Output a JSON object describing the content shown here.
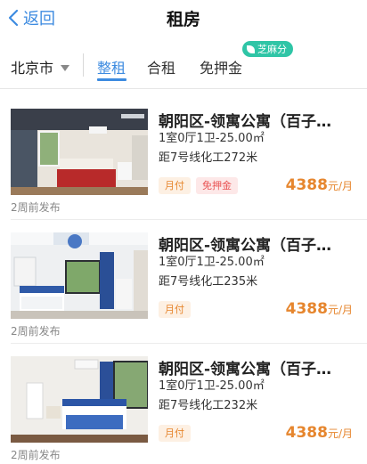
{
  "nav": {
    "back_label": "返回",
    "title": "租房"
  },
  "filter": {
    "city": "北京市",
    "tabs": [
      {
        "label": "整租",
        "active": true
      },
      {
        "label": "合租",
        "active": false
      },
      {
        "label": "免押金",
        "active": false
      }
    ],
    "sesame_badge": "芝麻分"
  },
  "listings": [
    {
      "title": "朝阳区-领寓公寓（百子…",
      "spec": "1室0厅1卫-25.00㎡",
      "distance": "距7号线化工272米",
      "tags": [
        "月付",
        "免押金"
      ],
      "price": "4388",
      "price_unit": "元/月",
      "posted": "2周前发布"
    },
    {
      "title": "朝阳区-领寓公寓（百子…",
      "spec": "1室0厅1卫-25.00㎡",
      "distance": "距7号线化工235米",
      "tags": [
        "月付"
      ],
      "price": "4388",
      "price_unit": "元/月",
      "posted": "2周前发布"
    },
    {
      "title": "朝阳区-领寓公寓（百子…",
      "spec": "1室0厅1卫-25.00㎡",
      "distance": "距7号线化工232米",
      "tags": [
        "月付"
      ],
      "price": "4388",
      "price_unit": "元/月",
      "posted": "2周前发布"
    }
  ],
  "colors": {
    "accent": "#3d8be0",
    "price": "#e6862e",
    "tag_pink": "#e95454",
    "sesame": "#2fc5a6"
  }
}
